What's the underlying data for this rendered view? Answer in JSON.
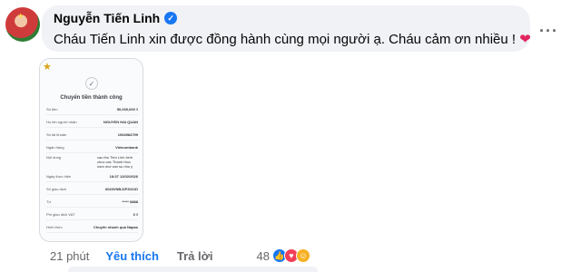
{
  "comment": {
    "author": "Nguyễn Tiến Linh",
    "text": "Cháu Tiến Linh xin được đồng hành cùng mọi người ạ. Cháu cảm ơn nhiều !",
    "more_icon": "more-horizontal-icon"
  },
  "receipt": {
    "title": "Chuyển tiền thành công",
    "rows": [
      {
        "label": "Số tiền",
        "value": "50,000,000 ₫"
      },
      {
        "label": "Họ tên người nhận",
        "value": "NGUYEN HAI QUAN"
      },
      {
        "label": "Số tài khoản",
        "value": "1064584799"
      },
      {
        "label": "Ngân hàng",
        "value": "Vietcombank"
      }
    ],
    "note_label": "Nội dung",
    "note_value": "cau thu Tien Linh kinh chuc cac Thanh Hoa nam moi van su nhu y",
    "rows2": [
      {
        "label": "Ngày thực hiện",
        "value": "18:37 12/02/2026"
      },
      {
        "label": "Số giao dịch",
        "value": "6043VNBJ2F2021D"
      },
      {
        "label": "Từ",
        "value": "***** 8888"
      },
      {
        "label": "Phí giao dịch VAT",
        "value": "0 ₫"
      },
      {
        "label": "Hình thức",
        "value": "Chuyển nhanh qua Napas"
      }
    ]
  },
  "actions": {
    "time": "21 phút",
    "like": "Yêu thích",
    "reply": "Trả lời",
    "reaction_count": "48"
  },
  "colors": {
    "accent": "#1877f2",
    "love": "#f33e58",
    "bubble": "#f0f2f5"
  }
}
